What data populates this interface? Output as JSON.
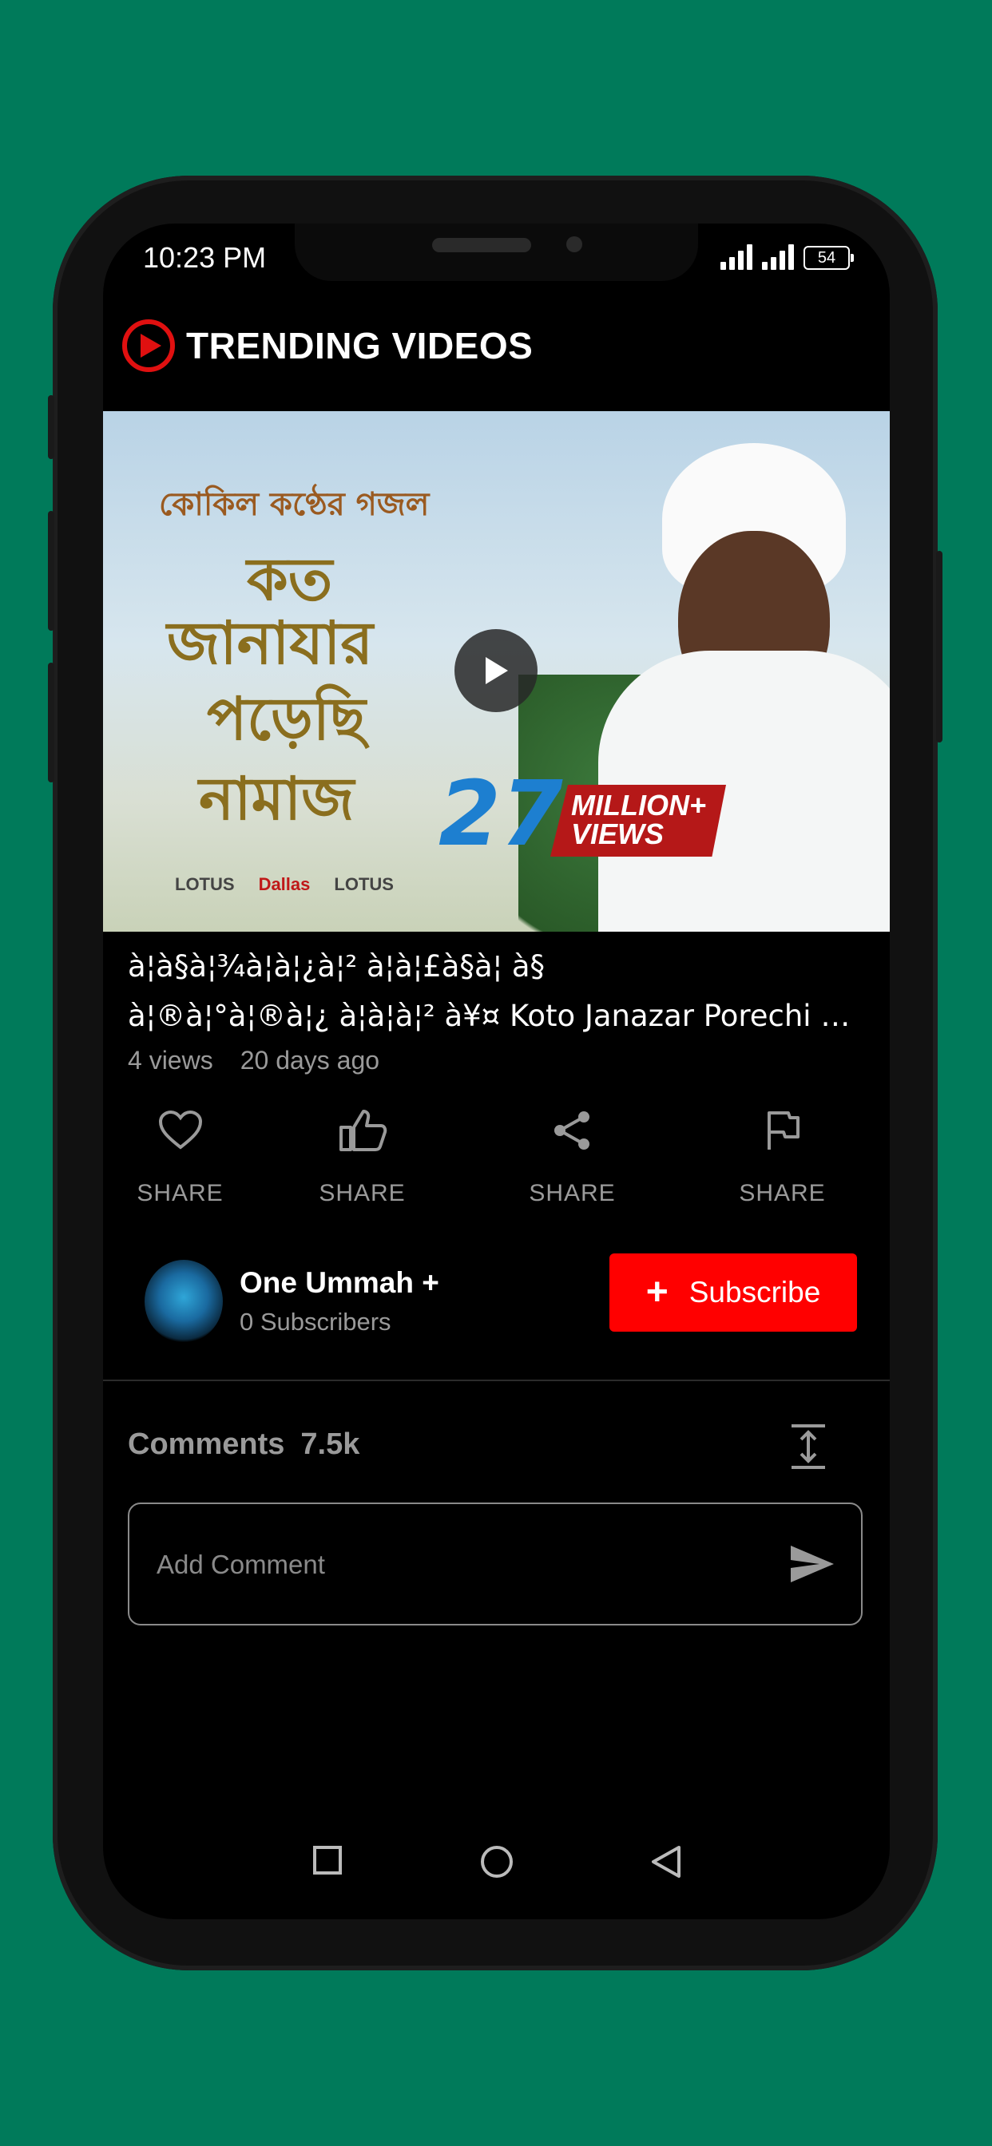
{
  "status_bar": {
    "time": "10:23 PM",
    "battery": "54"
  },
  "header": {
    "title": "TRENDING VIDEOS",
    "logo_icon": "play-circle-icon"
  },
  "video": {
    "thumbnail_text": {
      "bengali_top": "কোকিল কণ্ঠের গজল",
      "bengali_l1": "কত",
      "bengali_l2": "জানাযার",
      "bengali_l3": "পড়েছি",
      "bengali_l4": "নামাজ",
      "views_number": "27",
      "views_label_1": "MILLION+",
      "views_label_2": "VIEWS",
      "logos": [
        "LOTUS",
        "Dallas",
        "LOTUS"
      ]
    },
    "title_line1": "à¦à§à¦¾à¦à¦¿à¦² à¦à¦£à§à¦ à§",
    "title_line2": "à¦®à¦°à¦®à¦¿ à¦à¦à¦² à¥¤ Koto Janazar Porechi Namaj",
    "views": "4 views",
    "age": "20 days ago"
  },
  "actions": [
    {
      "icon": "heart-icon",
      "label": "SHARE"
    },
    {
      "icon": "thumbs-up-icon",
      "label": "SHARE"
    },
    {
      "icon": "share-icon",
      "label": "SHARE"
    },
    {
      "icon": "flag-icon",
      "label": "SHARE"
    }
  ],
  "channel": {
    "name": "One Ummah +",
    "subscribers": "0 Subscribers",
    "subscribe_label": "Subscribe"
  },
  "comments": {
    "label": "Comments",
    "count": "7.5k",
    "placeholder": "Add Comment"
  },
  "colors": {
    "background": "#007a5a",
    "accent_red": "#ff0000",
    "screen": "#000000"
  }
}
